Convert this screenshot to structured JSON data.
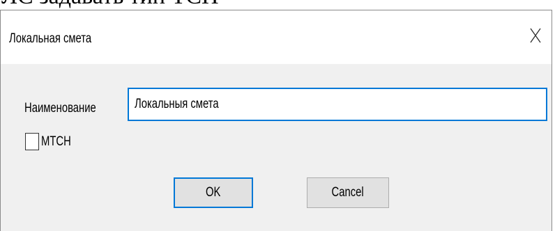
{
  "background": {
    "text": "ЛС задавать тип ТСН"
  },
  "dialog": {
    "title": "Локальная смета",
    "close_icon": "close-icon",
    "name_label": "Наименование",
    "name_value": "Локальныя смета",
    "checkbox_label": "MTCH",
    "checkbox_checked": false,
    "ok_label": "OK",
    "cancel_label": "Cancel"
  },
  "colors": {
    "accent": "#0078d7",
    "dialog_bg": "#f0f0f0",
    "button_bg": "#e1e1e1"
  }
}
